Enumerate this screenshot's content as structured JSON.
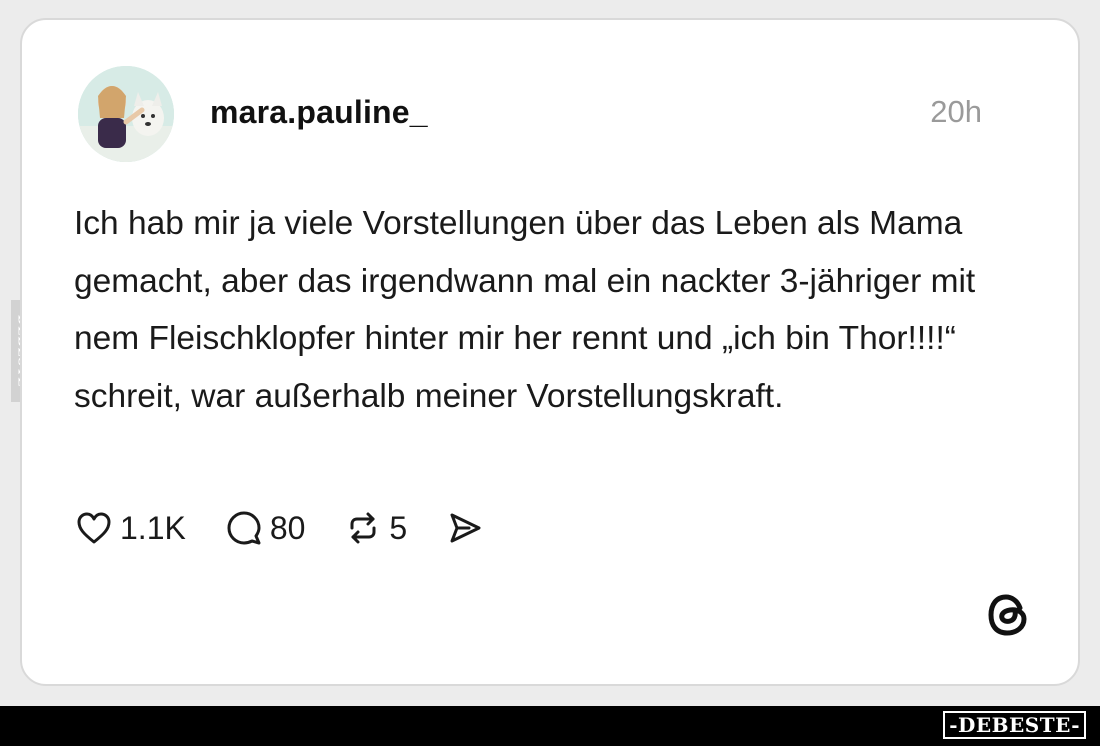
{
  "post": {
    "username": "mara.pauline_",
    "time": "20h",
    "text": "Ich hab mir ja viele Vorstellungen über das Leben als Mama gemacht, aber das irgendwann mal ein nackter 3-jähriger mit nem Fleischklopfer hinter mir her rennt und „ich bin Thor!!!!“ schreit, war außerhalb meiner Vorstellungskraft.",
    "likes": "1.1K",
    "comments": "80",
    "reposts": "5"
  },
  "icons": {
    "like": "heart-icon",
    "comment": "comment-bubble-icon",
    "repost": "repost-icon",
    "share": "send-icon",
    "brand": "threads-logo-icon"
  },
  "watermark": {
    "side": "DEBESTE",
    "bottom": "-DEBESTE-"
  },
  "colors": {
    "background": "#ececec",
    "card": "#ffffff",
    "text": "#1a1a1a",
    "muted": "#9a9a9a",
    "bar": "#000000"
  }
}
